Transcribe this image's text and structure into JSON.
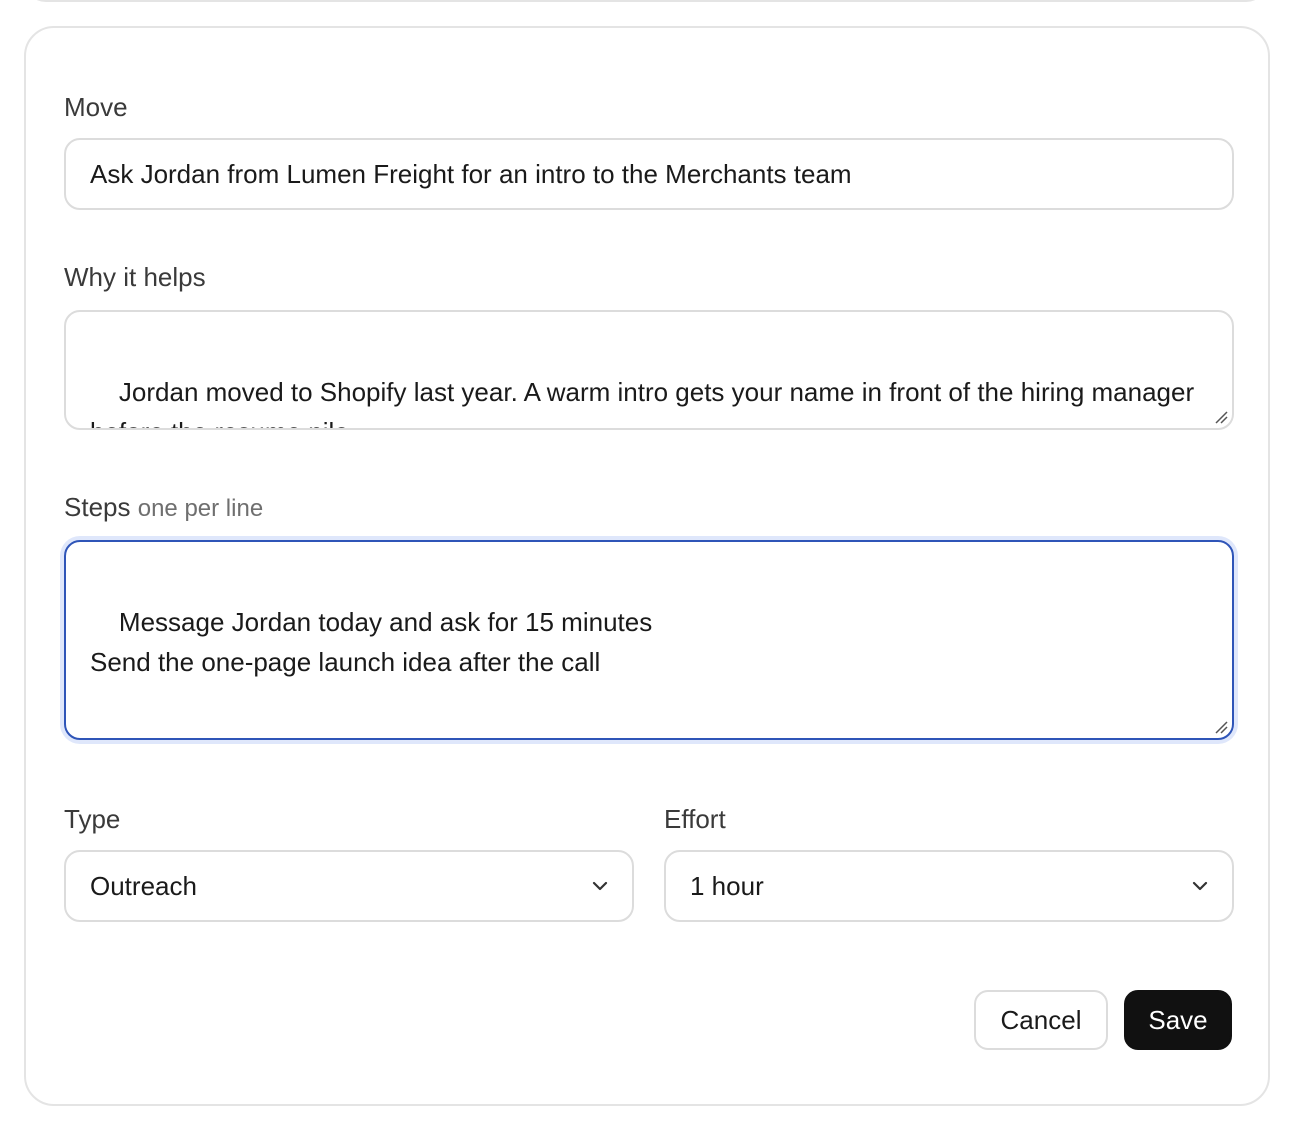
{
  "form": {
    "move": {
      "label": "Move",
      "value": "Ask Jordan from Lumen Freight for an intro to the Merchants team"
    },
    "why": {
      "label": "Why it helps",
      "value": "Jordan moved to Shopify last year. A warm intro gets your name in front of the hiring manager before the resume pile."
    },
    "steps": {
      "label": "Steps",
      "hint": "one per line",
      "value": "Message Jordan today and ask for 15 minutes\nSend the one-page launch idea after the call"
    },
    "type": {
      "label": "Type",
      "selected": "Outreach"
    },
    "effort": {
      "label": "Effort",
      "selected": "1 hour"
    }
  },
  "actions": {
    "cancel_label": "Cancel",
    "save_label": "Save"
  },
  "colors": {
    "focus_border": "#2f55b8",
    "primary_button": "#111111"
  }
}
